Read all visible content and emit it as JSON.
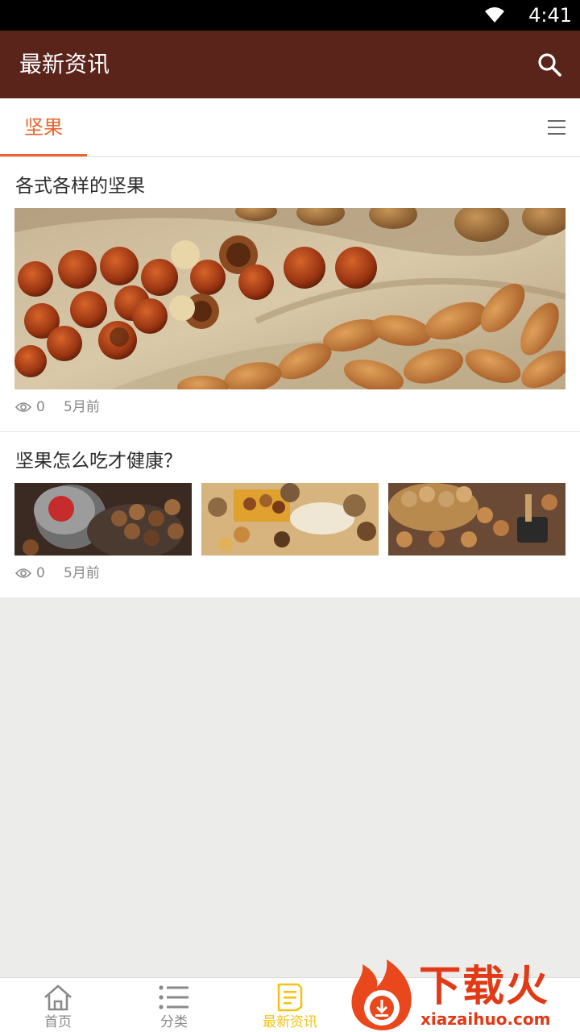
{
  "status_bar": {
    "time": "4:41"
  },
  "app_bar": {
    "title": "最新资讯",
    "search_icon": "search-icon"
  },
  "tabs": {
    "active_label": "坚果",
    "menu_icon": "hamburger-menu-icon"
  },
  "articles": [
    {
      "title": "各式各样的坚果",
      "image": "nuts-on-burlap-banner",
      "views": "0",
      "time_ago": "5月前"
    },
    {
      "title": "坚果怎么吃才健康？",
      "images": [
        "nuts-in-tin-thumb",
        "mixed-nuts-tray-thumb",
        "walnuts-basket-thumb"
      ],
      "views": "0",
      "time_ago": "5月前"
    }
  ],
  "bottom_nav": [
    {
      "label": "首页",
      "icon": "home-icon",
      "active": false
    },
    {
      "label": "分类",
      "icon": "list-icon",
      "active": false
    },
    {
      "label": "最新资讯",
      "icon": "document-icon",
      "active": true
    },
    {
      "label": "",
      "icon": "hidden-item",
      "active": false
    },
    {
      "label": "",
      "icon": "hidden-item",
      "active": false
    }
  ],
  "watermark": {
    "brand": "下载火",
    "site": "xiazaihuo.com"
  },
  "colors": {
    "app_bar": "#5a241b",
    "accent": "#f0622b",
    "nav_active": "#f2c418",
    "background": "#ececea"
  }
}
